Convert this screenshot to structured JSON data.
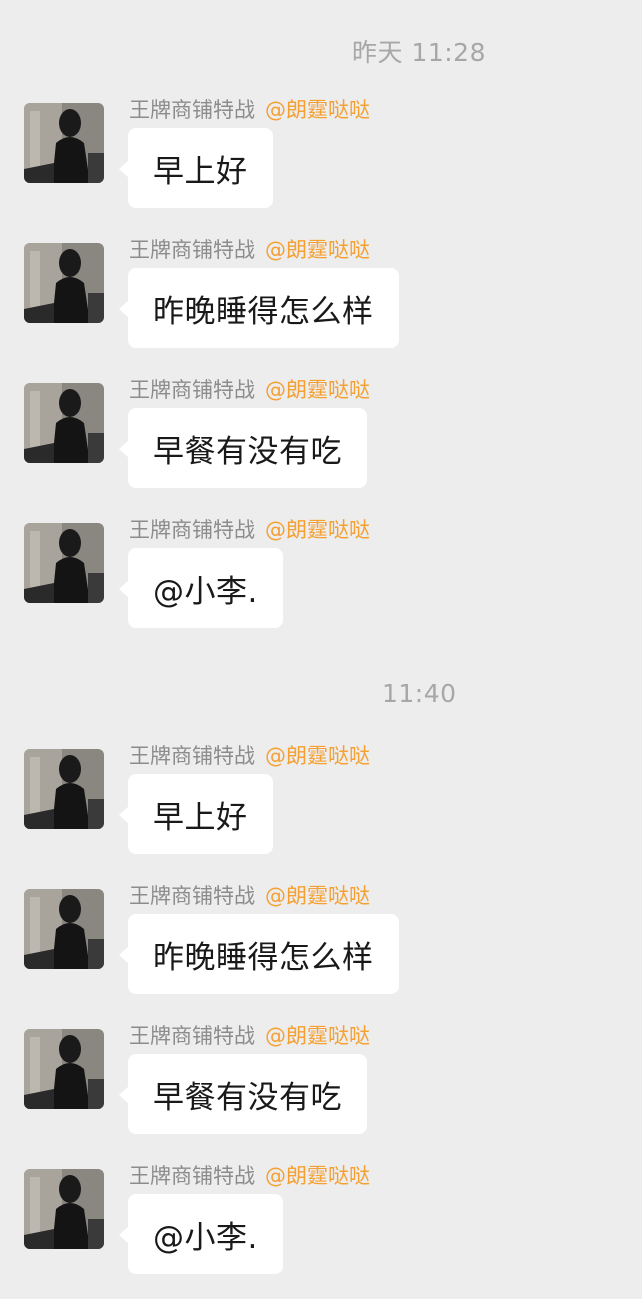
{
  "chat": {
    "sections": [
      {
        "time": "昨天 11:28",
        "messages": [
          {
            "sender": "王牌商铺特战",
            "group_tag": "@朗霆哒哒",
            "text": "早上好"
          },
          {
            "sender": "王牌商铺特战",
            "group_tag": "@朗霆哒哒",
            "text": "昨晚睡得怎么样"
          },
          {
            "sender": "王牌商铺特战",
            "group_tag": "@朗霆哒哒",
            "text": "早餐有没有吃"
          },
          {
            "sender": "王牌商铺特战",
            "group_tag": "@朗霆哒哒",
            "text": "@小李."
          }
        ]
      },
      {
        "time": "11:40",
        "messages": [
          {
            "sender": "王牌商铺特战",
            "group_tag": "@朗霆哒哒",
            "text": "早上好"
          },
          {
            "sender": "王牌商铺特战",
            "group_tag": "@朗霆哒哒",
            "text": "昨晚睡得怎么样"
          },
          {
            "sender": "王牌商铺特战",
            "group_tag": "@朗霆哒哒",
            "text": "早餐有没有吃"
          },
          {
            "sender": "王牌商铺特战",
            "group_tag": "@朗霆哒哒",
            "text": "@小李."
          }
        ]
      }
    ]
  },
  "colors": {
    "background": "#ededed",
    "bubble": "#ffffff",
    "sender_name": "#8c8c8c",
    "group_tag": "#f5a033",
    "timestamp": "#a7a7a7"
  },
  "icons": {
    "avatar": "user-avatar-photo"
  }
}
